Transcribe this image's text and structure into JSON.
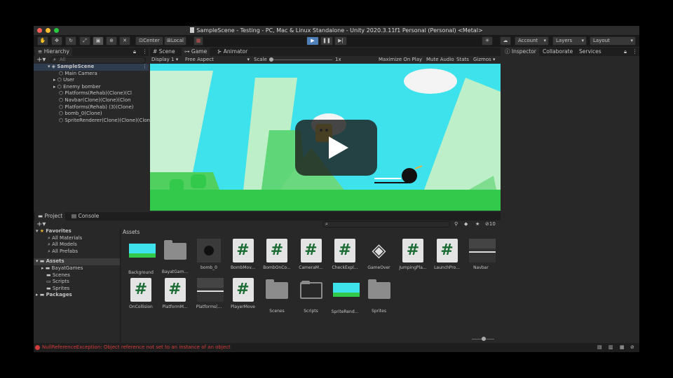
{
  "window": {
    "title": "SampleScene - Testing - PC, Mac & Linux Standalone - Unity 2020.3.11f1 Personal (Personal) <Metal>"
  },
  "toolbar": {
    "center_label": "Center",
    "local_label": "Local",
    "account_label": "Account",
    "layers_label": "Layers",
    "layout_label": "Layout"
  },
  "hierarchy": {
    "tab_label": "Hierarchy",
    "search_placeholder": "All",
    "scene": "SampleScene",
    "items": [
      "Main Camera",
      "User",
      "Enemy bomber",
      "Platforms(Rehab)(Clone)(Cl",
      "Navbar(Clone)(Clone)(Clon",
      "Platforms(Rehab) (3)(Clone)",
      "bomb_0(Clone)",
      "SpriteRenderer(Clone)(Clone)(Clon"
    ]
  },
  "center_tabs": {
    "scene": "Scene",
    "game": "Game",
    "animator": "Animator"
  },
  "game_bar": {
    "display": "Display 1",
    "aspect": "Free Aspect",
    "scale_label": "Scale",
    "scale_value": "1x",
    "maximize": "Maximize On Play",
    "mute": "Mute Audio",
    "stats": "Stats",
    "gizmos": "Gizmos"
  },
  "inspector": {
    "tab_label": "Inspector",
    "collaborate": "Collaborate",
    "services": "Services"
  },
  "project": {
    "tab_project": "Project",
    "tab_console": "Console",
    "hidden_count": "10",
    "favorites_label": "Favorites",
    "favorites": [
      "All Materials",
      "All Models",
      "All Prefabs"
    ],
    "assets_label": "Assets",
    "asset_folders": [
      "BayatGames",
      "Scenes",
      "Scripts",
      "Sprites"
    ],
    "packages_label": "Packages",
    "breadcrumb": "Assets",
    "grid": [
      {
        "name": "Background",
        "kind": "sprite"
      },
      {
        "name": "BayatGam...",
        "kind": "folder"
      },
      {
        "name": "bomb_0",
        "kind": "bomb"
      },
      {
        "name": "BombMov...",
        "kind": "script"
      },
      {
        "name": "BombOnCo...",
        "kind": "script"
      },
      {
        "name": "CameraM...",
        "kind": "script"
      },
      {
        "name": "CheckExpl...",
        "kind": "script"
      },
      {
        "name": "GameOver",
        "kind": "unity"
      },
      {
        "name": "JumpingPla...",
        "kind": "script"
      },
      {
        "name": "LaunchPro...",
        "kind": "script"
      },
      {
        "name": "Navbar",
        "kind": "bar"
      },
      {
        "name": "OnCollision",
        "kind": "script"
      },
      {
        "name": "PlatformM...",
        "kind": "script"
      },
      {
        "name": "Platforms(...",
        "kind": "bar"
      },
      {
        "name": "PlayerMove",
        "kind": "script"
      },
      {
        "name": "Scenes",
        "kind": "folder"
      },
      {
        "name": "Scripts",
        "kind": "folder-open"
      },
      {
        "name": "SpriteRend...",
        "kind": "sprite"
      },
      {
        "name": "Sprites",
        "kind": "folder"
      }
    ]
  },
  "status": {
    "message": "NullReferenceException: Object reference not set to an instance of an object",
    "error_color": "#d23c3c"
  }
}
